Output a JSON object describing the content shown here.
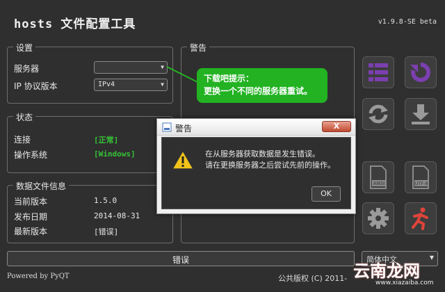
{
  "app": {
    "title": "hosts 文件配置工具",
    "version": "v1.9.8-SE beta"
  },
  "settings": {
    "legend": "设置",
    "server_label": "服务器",
    "server_value": "",
    "ip_label": "IP 协议版本",
    "ip_value": "IPv4"
  },
  "status": {
    "legend": "状态",
    "connection_label": "连接",
    "connection_value": "[正常]",
    "os_label": "操作系统",
    "os_value": "[Windows]"
  },
  "datafile": {
    "legend": "数据文件信息",
    "current_label": "当前版本",
    "current_value": "1.5.0",
    "release_label": "发布日期",
    "release_value": "2014-08-31",
    "latest_label": "最新版本",
    "latest_value": "[错误]"
  },
  "warning_panel": {
    "legend": "警告"
  },
  "tip": {
    "line1": "下载吧提示：",
    "line2": "更换一个不同的服务器重试。",
    "color": "#22b222"
  },
  "error_bar": {
    "text": "错误"
  },
  "language": {
    "value": "简体中文"
  },
  "footer": {
    "powered": "Powered by PyQT",
    "copyright": "公共版权 (C) 2011-"
  },
  "watermark": {
    "brand": "云南龙网",
    "url": "www.xiazaiba.com"
  },
  "dialog": {
    "title": "警告",
    "close_label": "X",
    "message_line1": "在从服务器获取数据是发生错误。",
    "message_line2": "请在更换服务器之后尝试先前的操作。",
    "ok_label": "OK"
  },
  "tools": {
    "menu_icon": "list-icon",
    "refresh_icon": "refresh-icon",
    "sync_icon": "sync-icon",
    "download_icon": "download-icon",
    "ansi_icon": "ansi-file-icon",
    "utf8_icon": "utf8-file-icon",
    "ansi_label": "ANSI",
    "utf8_label": "UTF-8",
    "settings_icon": "gear-icon",
    "exit_icon": "running-man-icon",
    "accent_purple": "#7b3fb0",
    "accent_red": "#e0443a"
  }
}
